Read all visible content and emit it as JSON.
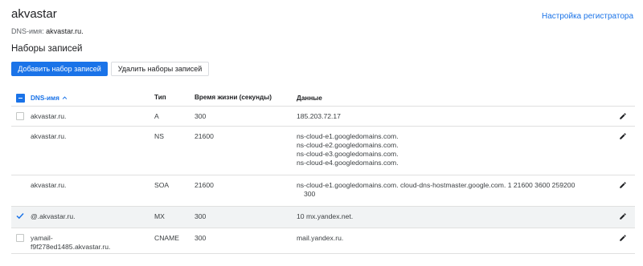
{
  "header": {
    "zone_name": "akvastar",
    "registrar_link": "Настройка регистратора",
    "dns_name_label": "DNS-имя:",
    "dns_name_value": "akvastar.ru."
  },
  "records_section": {
    "title": "Наборы записей",
    "add_button": "Добавить набор записей",
    "delete_button": "Удалить наборы записей"
  },
  "table": {
    "columns": {
      "name": "DNS-имя",
      "type": "Тип",
      "ttl": "Время жизни (секунды)",
      "data": "Данные"
    },
    "sort_icon": "arrow-up-icon",
    "rows": [
      {
        "name": "akvastar.ru.",
        "name_cont": "",
        "type": "A",
        "ttl": "300",
        "data": [
          "185.203.72.17"
        ],
        "has_checkbox": true,
        "selected": false
      },
      {
        "name": "akvastar.ru.",
        "name_cont": "",
        "type": "NS",
        "ttl": "21600",
        "data": [
          "ns-cloud-e1.googledomains.com.",
          "ns-cloud-e2.googledomains.com.",
          "ns-cloud-e3.googledomains.com.",
          "ns-cloud-e4.googledomains.com."
        ],
        "has_checkbox": false,
        "selected": false
      },
      {
        "name": "akvastar.ru.",
        "name_cont": "",
        "type": "SOA",
        "ttl": "21600",
        "data": [
          "ns-cloud-e1.googledomains.com. cloud-dns-hostmaster.google.com. 1 21600 3600 259200",
          "300"
        ],
        "has_checkbox": false,
        "selected": false
      },
      {
        "name": "@.akvastar.ru.",
        "name_cont": "",
        "type": "MX",
        "ttl": "300",
        "data": [
          "10 mx.yandex.net."
        ],
        "has_checkbox": true,
        "selected": true
      },
      {
        "name": "yamail-",
        "name_cont": "f9f278ed1485.akvastar.ru.",
        "type": "CNAME",
        "ttl": "300",
        "data": [
          "mail.yandex.ru."
        ],
        "has_checkbox": true,
        "selected": false
      }
    ]
  },
  "colors": {
    "accent": "#1a73e8",
    "selected_row": "#f1f3f4",
    "divider": "#e0e0e0"
  }
}
